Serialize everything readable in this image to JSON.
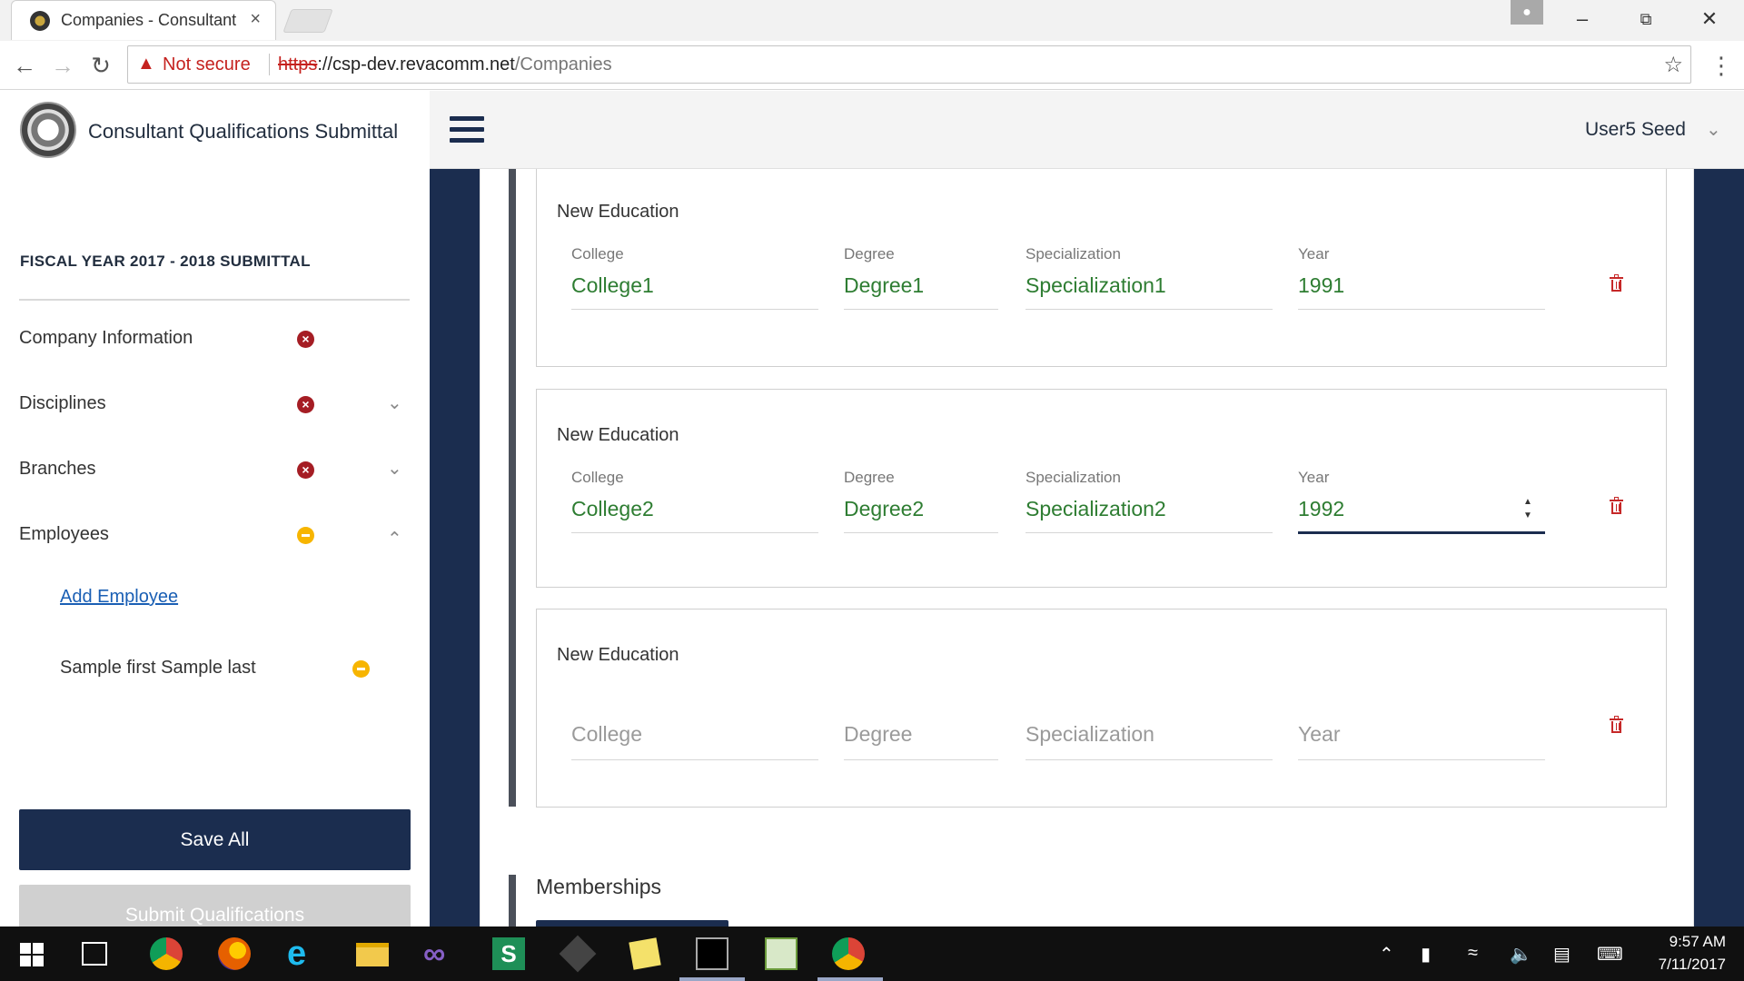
{
  "browser": {
    "tab_title": "Companies - Consultant",
    "tab_close": "×",
    "not_secure": "Not secure",
    "url_scheme": "https",
    "url_rest": "://csp-dev.revacomm.net",
    "url_path": "/Companies"
  },
  "header": {
    "app_title": "Consultant Qualifications Submittal",
    "user_name": "User5 Seed"
  },
  "sidebar": {
    "fiscal_heading": "FISCAL YEAR 2017 - 2018 SUBMITTAL",
    "items": [
      {
        "label": "Company Information",
        "status": "error"
      },
      {
        "label": "Disciplines",
        "status": "error"
      },
      {
        "label": "Branches",
        "status": "error"
      },
      {
        "label": "Employees",
        "status": "warning"
      }
    ],
    "add_employee": "Add Employee",
    "employee_name": "Sample first Sample last",
    "save_all": "Save All",
    "submit_qualifications": "Submit Qualifications"
  },
  "education": {
    "cards": [
      {
        "title": "New Education",
        "labels": {
          "college": "College",
          "degree": "Degree",
          "specialization": "Specialization",
          "year": "Year"
        },
        "values": {
          "college": "College1",
          "degree": "Degree1",
          "specialization": "Specialization1",
          "year": "1991"
        }
      },
      {
        "title": "New Education",
        "labels": {
          "college": "College",
          "degree": "Degree",
          "specialization": "Specialization",
          "year": "Year"
        },
        "values": {
          "college": "College2",
          "degree": "Degree2",
          "specialization": "Specialization2",
          "year": "1992"
        }
      },
      {
        "title": "New Education",
        "placeholders": {
          "college": "College",
          "degree": "Degree",
          "specialization": "Specialization",
          "year": "Year"
        }
      }
    ]
  },
  "memberships": {
    "title": "Memberships"
  },
  "taskbar": {
    "time": "9:57 AM",
    "date": "7/11/2017"
  },
  "colors": {
    "navy": "#1b2d4f",
    "field_value_green": "#2e7d32",
    "error_red": "#a51d24",
    "warning_yellow": "#f7b500",
    "trash_red": "#c62828"
  }
}
